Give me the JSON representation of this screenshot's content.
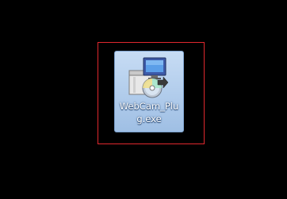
{
  "desktop": {
    "background_color": "#000000",
    "highlight_color": "#e0282e"
  },
  "icon": {
    "semantic": "installer-package-icon",
    "filename_line1": "WebCam_Plu",
    "filename_line2": "g.exe",
    "selected": true
  }
}
